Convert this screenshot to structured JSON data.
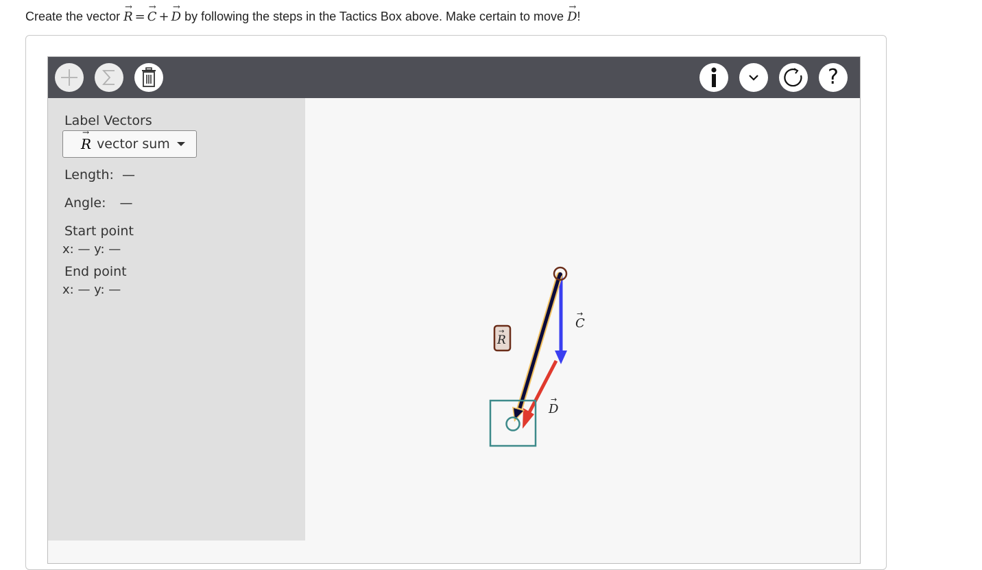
{
  "instruction": {
    "prefix": "Create the vector",
    "vec_r": "R",
    "eq": "=",
    "vec_c": "C",
    "plus": "+",
    "vec_d": "D",
    "middle": "by following the steps in the Tactics Box above. Make certain to move",
    "vec_d2": "D",
    "suffix": "!"
  },
  "toolbar": {
    "left_buttons": [
      "plus-icon",
      "sigma-icon",
      "trash-icon"
    ],
    "right_buttons": [
      "info-icon",
      "chevron-down-icon",
      "reset-icon",
      "help-icon"
    ],
    "help_glyph": "?"
  },
  "sidebar": {
    "label_vectors": "Label Vectors",
    "dropdown": {
      "vector_symbol": "R",
      "selected": "vector sum"
    },
    "length_label": "Length:",
    "length_value": "—",
    "angle_label": "Angle:",
    "angle_value": "—",
    "start_point_label": "Start point",
    "start_point_values": "x: — y: —",
    "end_point_label": "End point",
    "end_point_values": "x: — y: —"
  },
  "canvas": {
    "vectors": [
      {
        "name": "C",
        "label": "C",
        "color": "#3a3ff0"
      },
      {
        "name": "D",
        "label": "D",
        "color": "#e03a2e"
      },
      {
        "name": "R",
        "label": "R",
        "color": "#0b0b3b",
        "outline": "#f0c060"
      }
    ],
    "selection_box_color": "#3d8a8a",
    "handle_color_start": "#6b2e1a",
    "handle_color_end": "#3d8a8a"
  }
}
